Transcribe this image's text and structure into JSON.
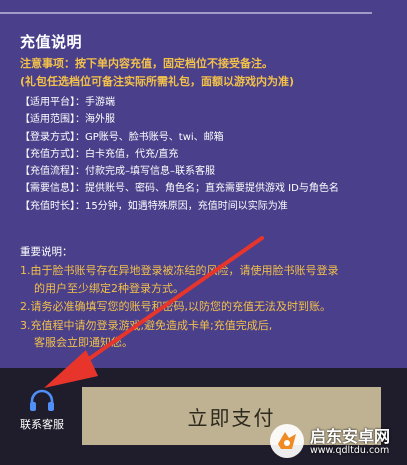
{
  "colors": {
    "panel": "#4a3f8a",
    "accent_gold": "#f2c14a",
    "pay_button": "#bfb292",
    "bottom_bar": "#1f1d2b",
    "arrow": "#e8352b"
  },
  "recharge": {
    "title": "充值说明",
    "notice_line1": "注意事项：按下单内容充值，固定档位不接受备注。",
    "notice_line2": "(礼包任选档位可备注实际所需礼包，面额以游戏内为准)",
    "info": [
      "【适用平台】：手游端",
      "【适用范围】：海外服",
      "【登录方式】：GP账号、脸书账号、twi、邮箱",
      "【充值方式】：白卡充值，代充/直充",
      "【充值流程】：付款完成–填写信息–联系客服",
      "【需要信息】：提供账号、密码、角色名；直充需要提供游戏 ID与角色名",
      "【充值时长】：15分钟，如遇特殊原因，充值时间以实际为准"
    ],
    "important_title": "重要说明：",
    "notes": [
      {
        "line1": "1.由于脸书账号存在异地登录被冻结的风险，请使用脸书账号登录",
        "line2": "的用户至少绑定2种登录方式。"
      },
      {
        "line1": "2.请务必准确填写您的账号和密码,以防您的充值无法及时到账。",
        "line2": ""
      },
      {
        "line1": "3.充值程中请勿登录游戏,避免造成卡单;充值完成后,",
        "line2": "客服会立即通知您。"
      }
    ]
  },
  "bottom": {
    "support_label": "联系客服",
    "support_icon": "headset-icon",
    "pay_label": "立即支付"
  },
  "watermark": {
    "text": "启东安卓网",
    "url": "www.qdltdu.com"
  }
}
